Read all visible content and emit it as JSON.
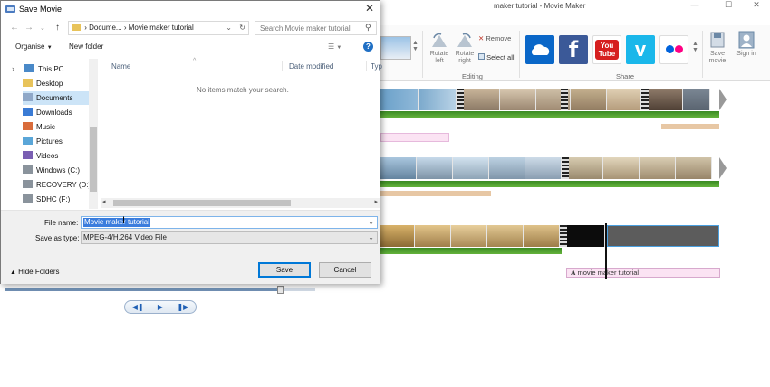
{
  "movie_maker": {
    "title": "maker tutorial - Movie Maker",
    "window_controls": {
      "minimize": "—",
      "maximize": "☐",
      "close": "✕"
    },
    "ribbon": {
      "rotate_left": "Rotate left",
      "rotate_right": "Rotate right",
      "remove": "Remove",
      "select_all": "Select all",
      "editing_label": "Editing",
      "share_label": "Share",
      "share_tiles": [
        {
          "icon": "onedrive-icon",
          "color": "#0a67c8"
        },
        {
          "icon": "facebook-icon",
          "text": "f",
          "color": "#3b5998"
        },
        {
          "icon": "youtube-icon",
          "text": "You Tube",
          "color": "#d61f1f"
        },
        {
          "icon": "vimeo-icon",
          "text": "v",
          "color": "#1ab7ea"
        },
        {
          "icon": "flickr-icon",
          "color": "#ffffff"
        }
      ],
      "save_movie": "Save movie",
      "sign_in": "Sign in"
    },
    "caption_text": "movie maker tutorial"
  },
  "dialog": {
    "title": "Save Movie",
    "breadcrumb": [
      "Docume...",
      "Movie maker tutorial"
    ],
    "search_placeholder": "Search Movie maker tutorial",
    "toolbar": {
      "organise": "Organise",
      "new_folder": "New folder"
    },
    "nav_items": [
      {
        "label": "This PC",
        "icon": "computer-icon"
      },
      {
        "label": "Desktop",
        "icon": "folder-icon"
      },
      {
        "label": "Documents",
        "icon": "documents-icon",
        "selected": true
      },
      {
        "label": "Downloads",
        "icon": "downloads-icon"
      },
      {
        "label": "Music",
        "icon": "music-icon"
      },
      {
        "label": "Pictures",
        "icon": "pictures-icon"
      },
      {
        "label": "Videos",
        "icon": "videos-icon"
      },
      {
        "label": "Windows (C:)",
        "icon": "drive-icon"
      },
      {
        "label": "RECOVERY (D:)",
        "icon": "drive-icon"
      },
      {
        "label": "SDHC (F:)",
        "icon": "drive-icon"
      }
    ],
    "columns": {
      "name": "Name",
      "date_modified": "Date modified",
      "type": "Typ"
    },
    "empty_message": "No items match your search.",
    "file_name_label": "File name:",
    "file_name_value": "Movie maker tutorial",
    "save_type_label": "Save as type:",
    "save_type_value": "MPEG-4/H.264 Video File",
    "hide_folders": "Hide Folders",
    "save_button": "Save",
    "cancel_button": "Cancel"
  },
  "colors": {
    "accent": "#0078d7",
    "selection": "#cce4f7",
    "audio_green": "#4e9e2c",
    "caption_pink": "#fbe3f3"
  }
}
